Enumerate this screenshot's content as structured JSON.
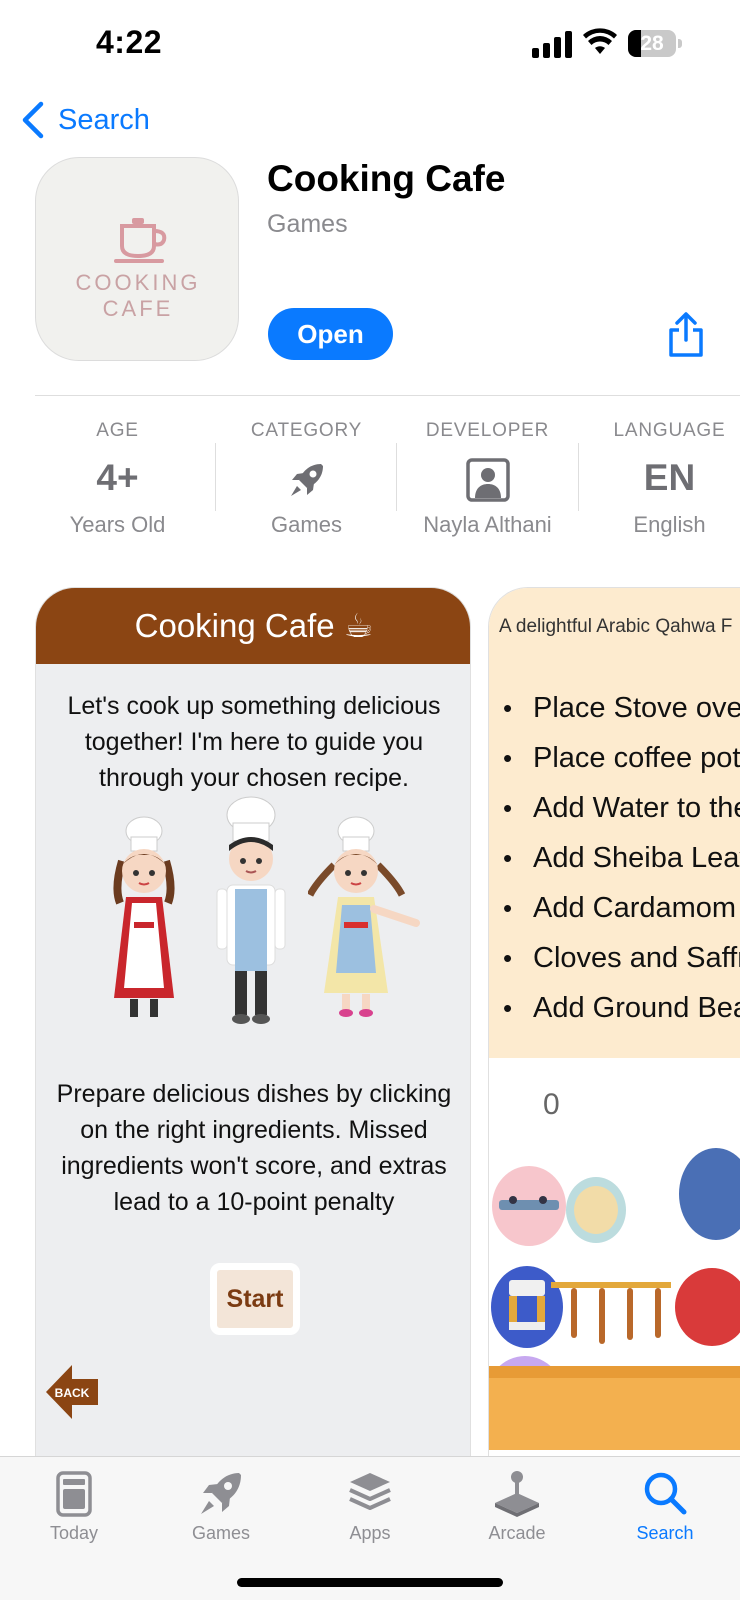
{
  "status_bar": {
    "time": "4:22",
    "battery": "28",
    "battery_level": 0.28
  },
  "nav": {
    "back_label": "Search"
  },
  "app": {
    "icon_wordmark": "COOKING CAFE",
    "title": "Cooking Cafe",
    "subtitle": "Games",
    "open_label": "Open"
  },
  "info": [
    {
      "label": "AGE",
      "value": "4+",
      "sub": "Years Old"
    },
    {
      "label": "CATEGORY",
      "value_icon": "rocket-icon",
      "sub": "Games"
    },
    {
      "label": "DEVELOPER",
      "value_icon": "person-icon",
      "sub": "Nayla Althani"
    },
    {
      "label": "LANGUAGE",
      "value": "EN",
      "sub": "English"
    }
  ],
  "screenshot1": {
    "title": "Cooking Cafe ☕",
    "intro": "Let's cook up something delicious together! I'm here to guide you through your chosen recipe.",
    "rules": "Prepare delicious dishes by clicking on the right ingredients. Missed ingredients won't score, and extras lead to a 10-point penalty",
    "start_label": "Start",
    "back_label": "BACK"
  },
  "screenshot2": {
    "caption": "A delightful Arabic Qahwa F",
    "steps": [
      "Place Stove over",
      "Place coffee pot",
      "Add Water to the",
      "Add Sheiba Leav",
      "Add Cardamom",
      "Cloves and Saffr",
      "Add Ground Bea"
    ],
    "score": "0"
  },
  "tabs": [
    {
      "label": "Today",
      "icon": "today-icon",
      "active": false
    },
    {
      "label": "Games",
      "icon": "rocket-icon",
      "active": false
    },
    {
      "label": "Apps",
      "icon": "apps-stack-icon",
      "active": false
    },
    {
      "label": "Arcade",
      "icon": "arcade-joystick-icon",
      "active": false
    },
    {
      "label": "Search",
      "icon": "search-icon",
      "active": true
    }
  ],
  "colors": {
    "accent": "#0a7aff",
    "gray_text": "#8a8a8e",
    "game_header_brown": "#8b4513",
    "recipe_panel": "#fdebcf"
  }
}
